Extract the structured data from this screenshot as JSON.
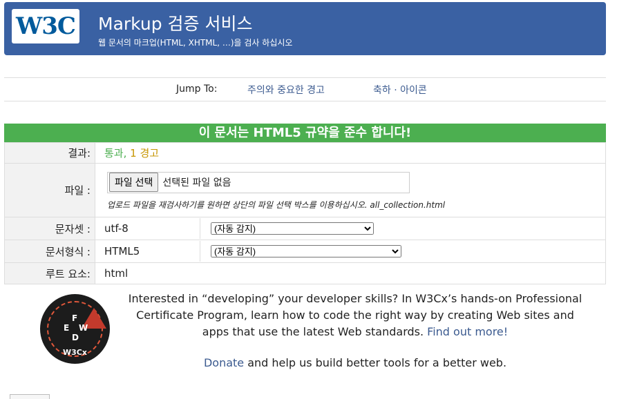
{
  "header": {
    "logo_text": "W3C",
    "title": "Markup 검증 서비스",
    "subtitle": "웹 문서의 마크업(HTML, XHTML, …)을 검사 하십시오"
  },
  "jump": {
    "label": "Jump To:",
    "links": [
      "주의와 중요한 경고",
      "축하 · 아이콘"
    ]
  },
  "result_banner": "이 문서는 HTML5 규약을 준수 합니다!",
  "rows": {
    "result": {
      "label": "결과:",
      "ok": "통과,",
      "warn": "1 경고"
    },
    "file": {
      "label": "파일 :",
      "button": "파일 선택",
      "status": "선택된 파일 없음",
      "hint": "업로드 파일을 재검사하기를 원하면 상단의 파일 선택 박스를 이용하십시오. all_collection.html"
    },
    "charset": {
      "label": "문자셋 :",
      "value": "utf-8",
      "select": "(자동 감지)"
    },
    "doctype": {
      "label": "문서형식 :",
      "value": "HTML5",
      "select": "(자동 감지)"
    },
    "root": {
      "label": "루트 요소:",
      "value": "html"
    }
  },
  "promo": {
    "badge_brand": "W3Cx",
    "badge_letters": [
      "F",
      "E",
      "W",
      "D"
    ],
    "text_before": "Interested in “developing” your developer skills? In W3Cx’s hands-on Professional Certificate Program, learn how to code the right way by creating Web sites and apps that use the latest Web standards. ",
    "link": "Find out more!",
    "donate_link": "Donate",
    "donate_rest": " and help us build better tools for a better web."
  },
  "colors": {
    "header_bg": "#3a61a3",
    "pass_green": "#4caf50",
    "warning": "#c69500",
    "link": "#3b5a8f"
  }
}
